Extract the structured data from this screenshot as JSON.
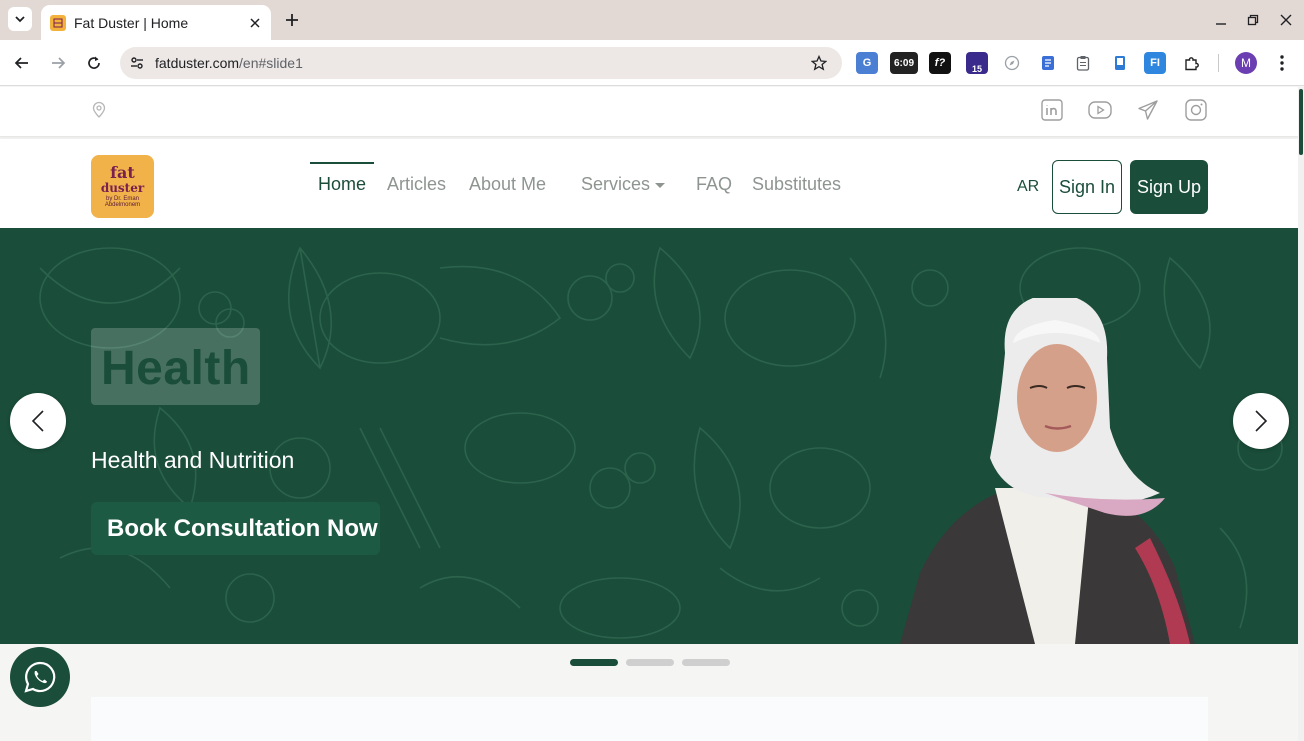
{
  "browser": {
    "tab_title": "Fat Duster | Home",
    "url_host": "fatduster.com",
    "url_path": "/en#slide1",
    "ext_badge_time": "6:09",
    "ext_badge_count": "15",
    "profile_initial": "M"
  },
  "site": {
    "logo": {
      "line1": "fat",
      "line2": "duster",
      "line3": "by Dr. Eman Abdelmonem"
    },
    "nav": {
      "home": "Home",
      "articles": "Articles",
      "about": "About Me",
      "services": "Services",
      "faq": "FAQ",
      "substitutes": "Substitutes"
    },
    "lang": "AR",
    "sign_in": "Sign In",
    "sign_up": "Sign Up"
  },
  "hero": {
    "headline": "Health",
    "subtitle": "Health and Nutrition",
    "cta": "Book Consultation Now",
    "slides": 3,
    "active_slide": 1
  },
  "colors": {
    "brand_green": "#1a4d3a",
    "logo_orange": "#f1b24a",
    "logo_maroon": "#7a1f4f"
  },
  "icons": [
    "location-icon",
    "linkedin-icon",
    "youtube-icon",
    "telegram-icon",
    "instagram-icon",
    "whatsapp-icon",
    "chevron-left-icon",
    "chevron-right-icon"
  ]
}
